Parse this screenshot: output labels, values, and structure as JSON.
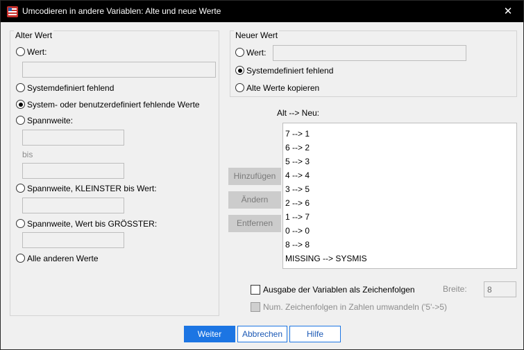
{
  "window": {
    "title": "Umcodieren in andere Variablen: Alte und neue Werte",
    "close_glyph": "✕"
  },
  "old_value": {
    "legend": "Alter Wert",
    "value_label": "Wert:",
    "system_missing_label": "Systemdefiniert fehlend",
    "system_or_user_missing_label": "System- oder benutzerdefiniert fehlende Werte",
    "range_label": "Spannweite:",
    "range_through": "bis",
    "range_lowest_label": "Spannweite, KLEINSTER bis Wert:",
    "range_highest_label": "Spannweite, Wert bis GRÖSSTER:",
    "all_other_label": "Alle anderen Werte",
    "selected": "system_or_user_missing"
  },
  "new_value": {
    "legend": "Neuer Wert",
    "value_label": "Wert:",
    "system_missing_label": "Systemdefiniert fehlend",
    "copy_old_label": "Alte Werte kopieren",
    "selected": "system_missing"
  },
  "mapping": {
    "header": "Alt --> Neu:",
    "items": [
      "7 --> 1",
      "6 --> 2",
      "5 --> 3",
      "4 --> 4",
      "3 --> 5",
      "2 --> 6",
      "1 --> 7",
      "0 --> 0",
      "8 --> 8",
      "MISSING --> SYSMIS"
    ]
  },
  "mapping_buttons": {
    "add": "Hinzufügen",
    "change": "Ändern",
    "remove": "Entfernen"
  },
  "options": {
    "output_as_strings_label": "Ausgabe der Variablen als Zeichenfolgen",
    "width_label": "Breite:",
    "width_value": "8",
    "convert_numeric_label": "Num. Zeichenfolgen in Zahlen umwandeln ('5'->5)"
  },
  "footer": {
    "continue": "Weiter",
    "cancel": "Abbrechen",
    "help": "Hilfe"
  },
  "colors": {
    "accent": "#1c75e3",
    "titlebar": "#000000"
  }
}
